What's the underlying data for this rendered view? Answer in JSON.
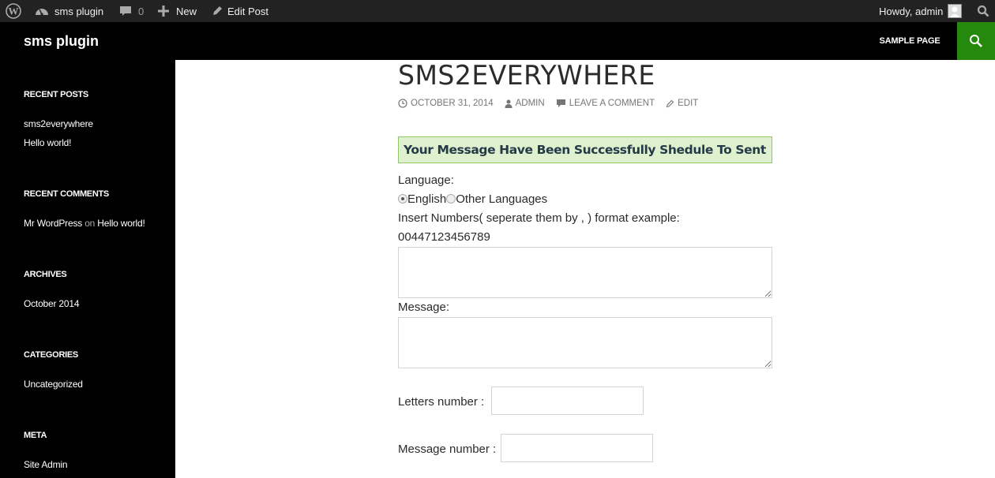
{
  "adminbar": {
    "site_name": "sms plugin",
    "comments_count": "0",
    "new_label": "New",
    "edit_post_label": "Edit Post",
    "greeting": "Howdy, admin"
  },
  "header": {
    "site_title": "sms plugin",
    "nav": [
      {
        "label": "SAMPLE PAGE"
      }
    ],
    "accent_color": "#24890d"
  },
  "sidebar": {
    "recent_posts": {
      "title": "RECENT POSTS",
      "items": [
        "sms2everywhere",
        "Hello world!"
      ]
    },
    "recent_comments": {
      "title": "RECENT COMMENTS",
      "author": "Mr WordPress",
      "on": "on",
      "post": "Hello world!"
    },
    "archives": {
      "title": "ARCHIVES",
      "items": [
        "October 2014"
      ]
    },
    "categories": {
      "title": "CATEGORIES",
      "items": [
        "Uncategorized"
      ]
    },
    "meta": {
      "title": "META",
      "items": [
        "Site Admin"
      ]
    }
  },
  "post": {
    "title": "SMS2EVERYWHERE",
    "date": "OCTOBER 31, 2014",
    "author": "ADMIN",
    "comment_link": "LEAVE A COMMENT",
    "edit_link": "EDIT"
  },
  "form": {
    "success_message": "Your Message Have Been Successfully Shedule To Sent",
    "language_label": "Language:",
    "language_options": [
      {
        "label": "English",
        "checked": true
      },
      {
        "label": "Other Languages",
        "checked": false
      }
    ],
    "numbers_label": "Insert Numbers( seperate them by , ) format example:",
    "numbers_example": "00447123456789",
    "numbers_value": "",
    "message_label": "Message:",
    "message_value": "",
    "letters_label": "Letters number :",
    "letters_value": "",
    "message_number_label": "Message number :",
    "message_number_value": ""
  }
}
